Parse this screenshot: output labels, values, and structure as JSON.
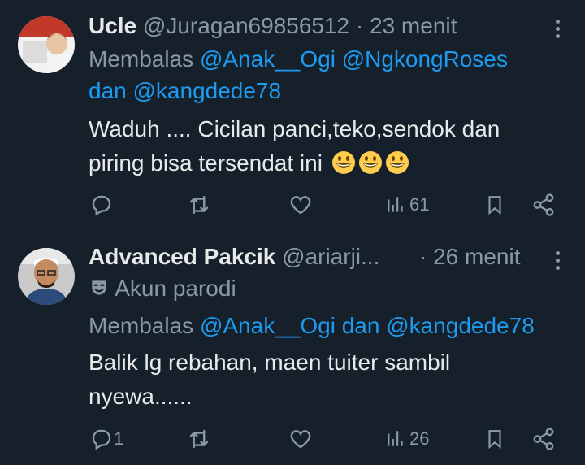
{
  "tweets": [
    {
      "name": "Ucle",
      "handle": "@Juragan69856512",
      "time": "· 23 menit",
      "reply_prefix": "Membalas",
      "reply_line1_mentions": "@Anak__Ogi @NgkongRoses",
      "reply_line2_and": "dan",
      "reply_line2_mention": "@kangdede78",
      "text_line1": "Waduh .... Cicilan panci,teko,sendok dan",
      "text_line2": "piring bisa tersendat ini",
      "emoji": [
        "grinning-face",
        "grinning-face",
        "grinning-face"
      ],
      "replies": "",
      "views": "61"
    },
    {
      "name": "Advanced Pakcik",
      "handle": "@ariarji...",
      "time": "· 26 menit",
      "label_icon": "theater-mask-icon",
      "label": "Akun parodi",
      "reply_prefix": "Membalas",
      "reply_mention1": "@Anak__Ogi",
      "reply_and": "dan",
      "reply_mention2": "@kangdede78",
      "text_line1": "Balik lg rebahan, maen tuiter sambil",
      "text_line2": "nyewa......",
      "replies": "1",
      "views": "26"
    }
  ],
  "colors": {
    "background": "#15202b",
    "text": "#e7e9ea",
    "muted": "#8b98a5",
    "link": "#1d9bf0",
    "divider": "#38444d"
  }
}
